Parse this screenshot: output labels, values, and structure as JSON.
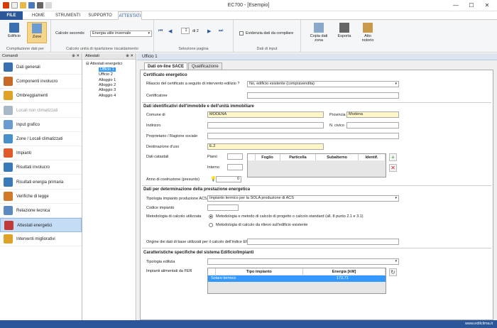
{
  "window": {
    "title": "EC700 - [Esempio]",
    "minimize": "—",
    "maximize": "☐",
    "close": "✕"
  },
  "tabs": [
    "FILE",
    "HOME",
    "STRUMENTI",
    "SUPPORTO",
    "ATTESTATI"
  ],
  "ribbon": {
    "edificio": "Edificio",
    "zone": "Zone",
    "group1": "Compilazione dati per",
    "calcolo_label": "Calcolo secondo",
    "calcolo_value": "Energia utile invernale",
    "group2": "Calcolo unità di ripartizione riscaldamento",
    "page_value": "1",
    "page_of": "di 2",
    "group3": "Selezione pagina",
    "evidenzia": "Evidenzia dati da compilare",
    "group4": "Dati di input",
    "copia": "Copia dati zona",
    "esporta": "Esporta",
    "atto": "Atto notorio"
  },
  "comandi": {
    "title": "Comandi",
    "items": [
      {
        "label": "Dati generali",
        "color": "#3a6fb0"
      },
      {
        "label": "Componenti involucro",
        "color": "#c8692a"
      },
      {
        "label": "Ombreggiamenti",
        "color": "#e0a32a"
      },
      {
        "label": "Locali non climatizzati",
        "color": "#a8b8c8"
      },
      {
        "label": "Input grafico",
        "color": "#6a9bd1"
      },
      {
        "label": "Zone / Locali climatizzati",
        "color": "#4a90c8"
      },
      {
        "label": "Impianti",
        "color": "#e05a2a"
      },
      {
        "label": "Risultati involucro",
        "color": "#3a7ab8"
      },
      {
        "label": "Risultati energia primaria",
        "color": "#3a7ab8"
      },
      {
        "label": "Verifiche di legge",
        "color": "#d07a2a"
      },
      {
        "label": "Relazione tecnica",
        "color": "#5a8ac0"
      },
      {
        "label": "Attestati energetici",
        "color": "#c03a3a"
      },
      {
        "label": "Interventi migliorativi",
        "color": "#e0a32a"
      }
    ]
  },
  "attestati_panel": {
    "title": "Attestati",
    "root": "Attestati energetici",
    "items": [
      "Ufficio 1",
      "Ufficio 2",
      "Alloggio 1",
      "Alloggio 2",
      "Alloggio 3",
      "Alloggio 4"
    ]
  },
  "doc": {
    "title": "Ufficio 1",
    "tab1": "Dati on-line SACE",
    "tab2": "Qualificazione",
    "sec_cert": "Certificato energetico",
    "rilascio_label": "Rilascio del certificato a seguito di intervento edilizio ?",
    "rilascio_value": "No, edificio esistente (compravendita)",
    "certificatore_label": "Certificatore",
    "sec_ident": "Dati identificativi dell'immobile e dell'unità immobiliare",
    "comune_label": "Comune di",
    "comune_value": "MODENA",
    "provincia_label": "Provincia",
    "provincia_value": "Modena",
    "indirizzo_label": "Indirizzo",
    "civico_label": "N. civico",
    "proprietario_label": "Proprietario / Ragione sociale",
    "destinazione_label": "Destinazione d'uso",
    "destinazione_value": "E.2",
    "catastali_label": "Dati catastali",
    "piano_label": "Piano",
    "interno_label": "Interno",
    "catastali_cols": [
      "Foglio",
      "Particella",
      "Subalterno",
      "Identif."
    ],
    "anno_label": "Anno di costruzione (presunto)",
    "anno_value": "0",
    "sec_prest": "Dati per determinazione della prestazione energetica",
    "tipologia_acs_label": "Tipologia impianto produzione ACS",
    "tipologia_acs_value": "Impianto termico per la SOLA produzione di ACS",
    "codice_label": "Codice impianto",
    "metodologia_label": "Metodologia di calcolo utilizzata",
    "radio1": "Metodologia e metodo di calcolo di progetto o calcolo standard (all. 8 punto 2.1 e 3.1)",
    "radio2": "Metodologia di calcolo da rilievo sull'edificio esistente",
    "origine_label": "Origine dei dati di base utilizzati per il calcolo dell'indice EP",
    "sec_caratt": "Caratteristiche specifiche del sistema Edificio/Impianti",
    "tip_edilizia_label": "Tipologia edilizia",
    "fer_label": "Impianti alimentati da FER",
    "fer_cols": [
      "Tipo impianto",
      "Energia  [kW]"
    ],
    "fer_rows": [
      {
        "tipo": "Solare termico",
        "energia": "172,71"
      }
    ]
  },
  "status": {
    "website": "www.edilclima.it"
  },
  "colors": {
    "accent": "#2b579a",
    "selection": "#3399ff",
    "highlight": "#fff7c8"
  }
}
